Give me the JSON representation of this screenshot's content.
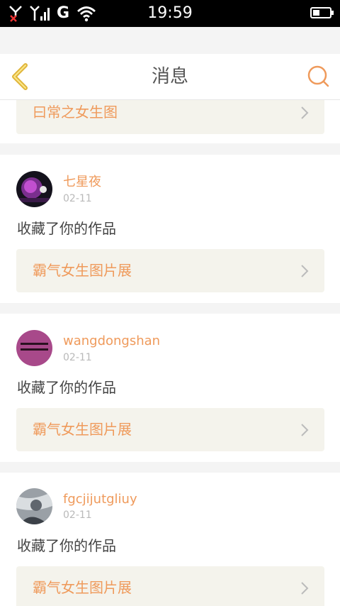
{
  "status_bar": {
    "carrier": "G",
    "time": "19:59",
    "battery_level": 0.4
  },
  "header": {
    "title": "消息",
    "back_icon": "chevron-left-icon",
    "search_icon": "search-icon"
  },
  "top_card": {
    "work_title": "曰常之女生图"
  },
  "messages": [
    {
      "username": "七星夜",
      "date": "02-11",
      "action": "收藏了你的作品",
      "work_title": "霸气女生图片展"
    },
    {
      "username": "wangdongshan",
      "date": "02-11",
      "action": "收藏了你的作品",
      "work_title": "霸气女生图片展"
    },
    {
      "username": "fgcjijutgliuy",
      "date": "02-11",
      "action": "收藏了你的作品",
      "work_title": "霸气女生图片展"
    }
  ],
  "colors": {
    "accent": "#ef9a5b",
    "back_icon": "#e0b53a",
    "card_link_bg": "#f4f3ec",
    "page_bg": "#f4f4f4"
  }
}
